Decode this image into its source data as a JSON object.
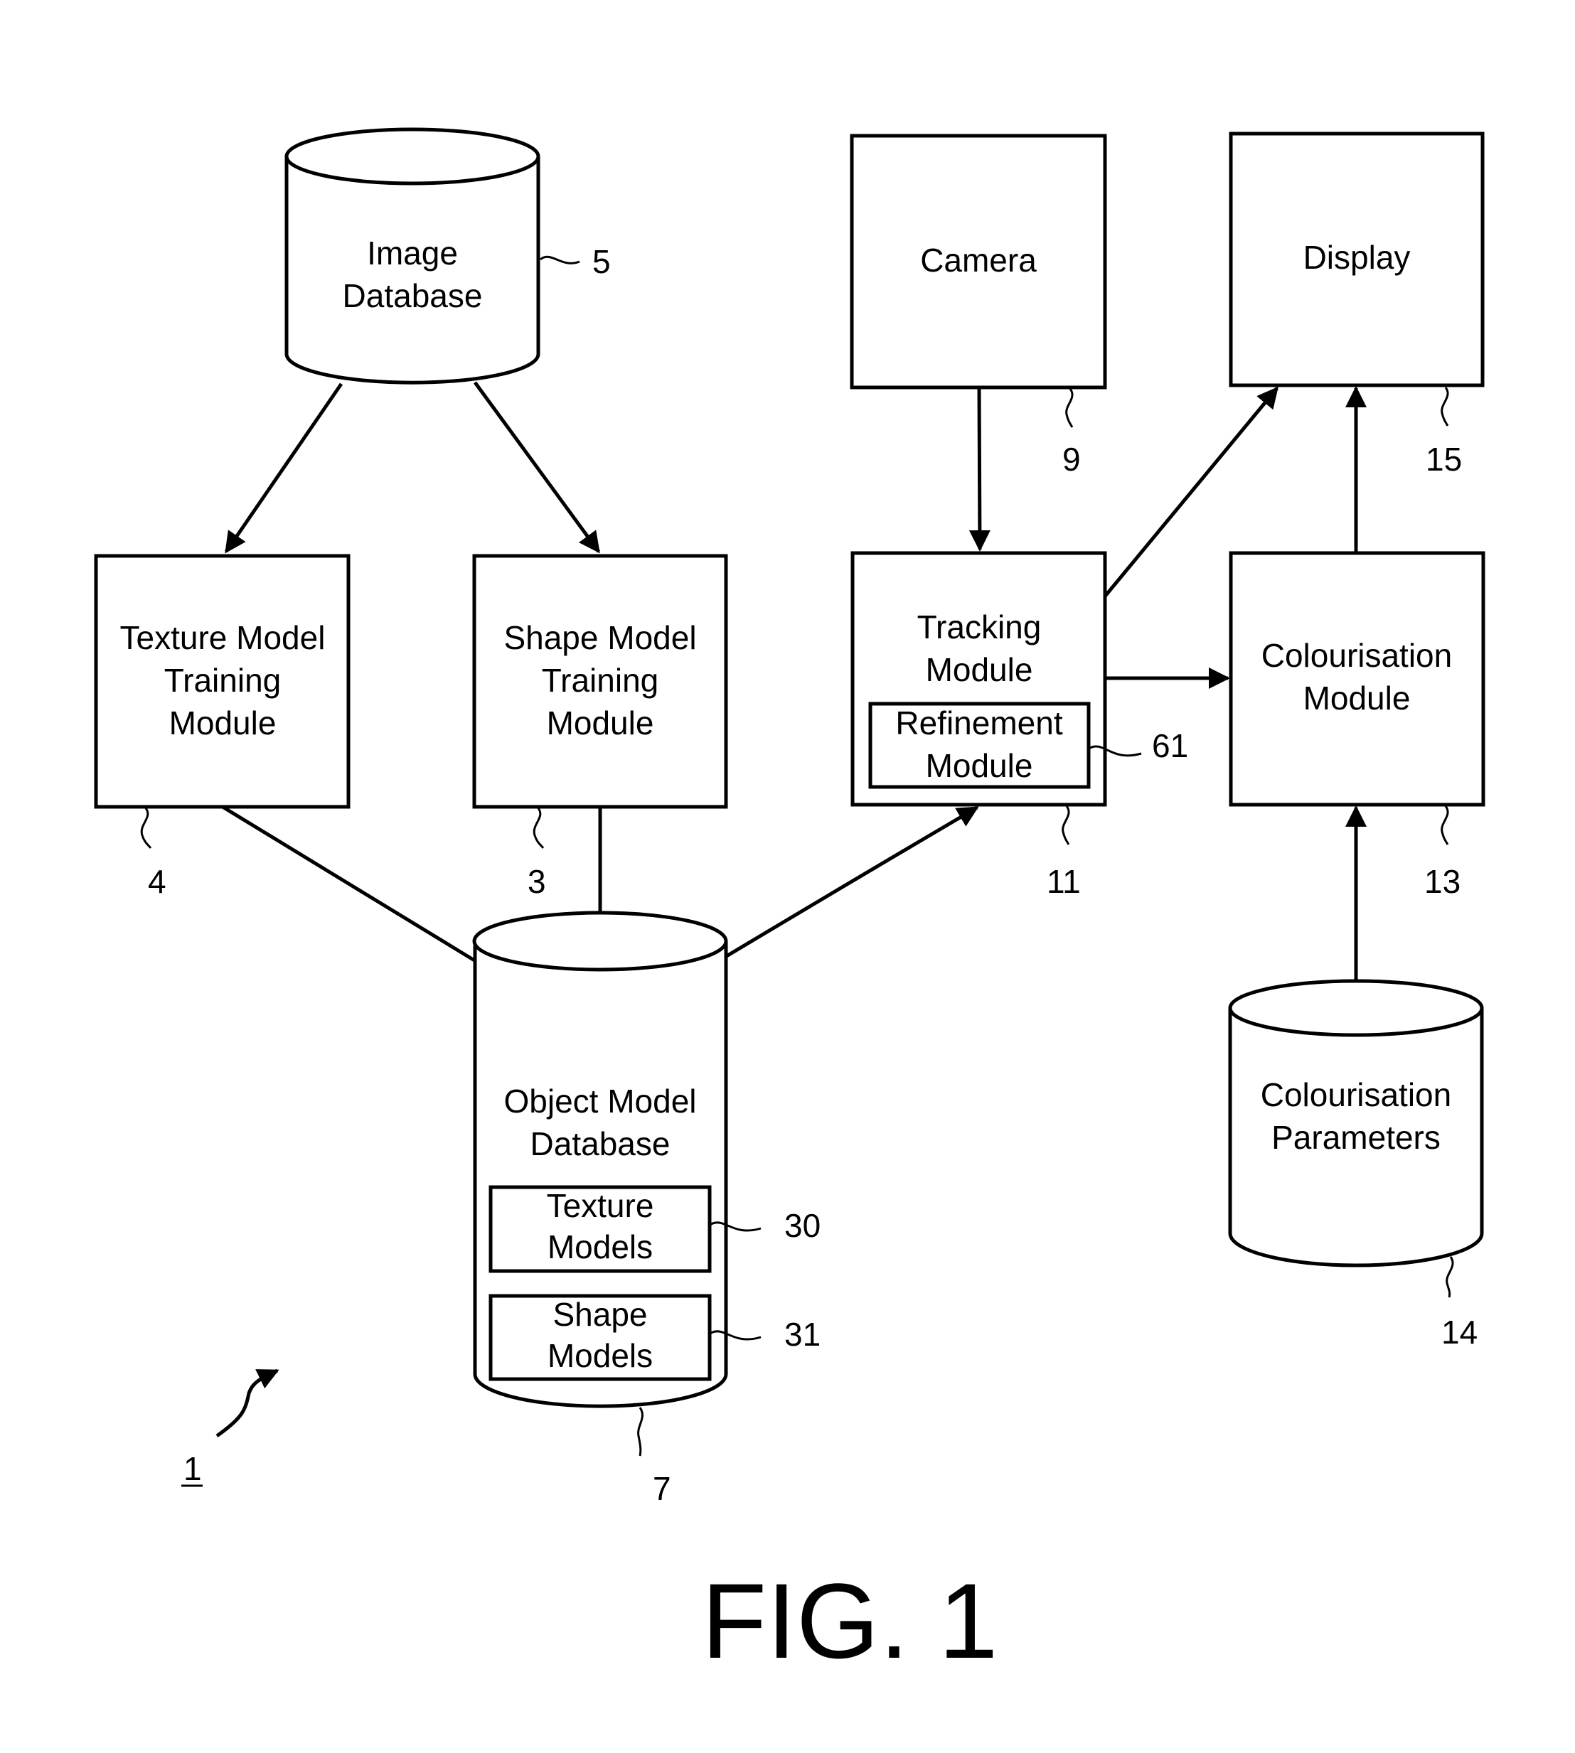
{
  "figure": {
    "title": "FIG. 1",
    "system_ref": "1"
  },
  "nodes": {
    "image_database": {
      "lines": [
        "Image",
        "Database"
      ],
      "ref": "5"
    },
    "texture_training": {
      "lines": [
        "Texture Model",
        "Training",
        "Module"
      ],
      "ref": "4"
    },
    "shape_training": {
      "lines": [
        "Shape Model",
        "Training",
        "Module"
      ],
      "ref": "3"
    },
    "object_model_db": {
      "lines": [
        "Object Model",
        "Database"
      ],
      "ref": "7"
    },
    "texture_models": {
      "lines": [
        "Texture",
        "Models"
      ],
      "ref": "30"
    },
    "shape_models": {
      "lines": [
        "Shape",
        "Models"
      ],
      "ref": "31"
    },
    "camera": {
      "lines": [
        "Camera"
      ],
      "ref": "9"
    },
    "display": {
      "lines": [
        "Display"
      ],
      "ref": "15"
    },
    "tracking": {
      "lines": [
        "Tracking",
        "Module"
      ],
      "ref": "11"
    },
    "refinement": {
      "lines": [
        "Refinement",
        "Module"
      ],
      "ref": "61"
    },
    "colourisation": {
      "lines": [
        "Colourisation",
        "Module"
      ],
      "ref": "13"
    },
    "colourisation_params": {
      "lines": [
        "Colourisation",
        "Parameters"
      ],
      "ref": "14"
    }
  },
  "edges": [
    {
      "from": "image_database",
      "to": "texture_training"
    },
    {
      "from": "image_database",
      "to": "shape_training"
    },
    {
      "from": "texture_training",
      "to": "object_model_db"
    },
    {
      "from": "shape_training",
      "to": "object_model_db"
    },
    {
      "from": "object_model_db",
      "to": "tracking"
    },
    {
      "from": "camera",
      "to": "tracking"
    },
    {
      "from": "tracking",
      "to": "display"
    },
    {
      "from": "tracking",
      "to": "colourisation"
    },
    {
      "from": "colourisation",
      "to": "display"
    },
    {
      "from": "colourisation_params",
      "to": "colourisation"
    }
  ]
}
